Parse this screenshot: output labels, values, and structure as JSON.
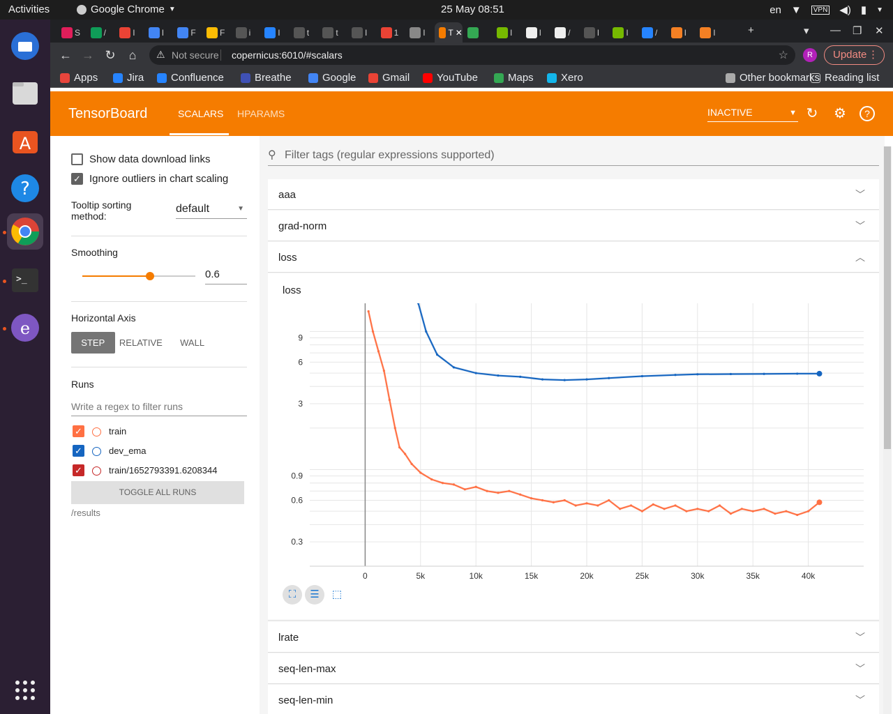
{
  "system": {
    "activities": "Activities",
    "app_name": "Google Chrome",
    "clock": "25 May  08:51",
    "lang": "en"
  },
  "browser": {
    "tabs": [
      {
        "label": "S",
        "color": "#e01e5a"
      },
      {
        "label": "/",
        "color": "#0f9d58"
      },
      {
        "label": "I",
        "color": "#ea4335"
      },
      {
        "label": "I",
        "color": "#4285f4"
      },
      {
        "label": "F",
        "color": "#4285f4"
      },
      {
        "label": "F",
        "color": "#fbbc04"
      },
      {
        "label": "i",
        "color": "#555555"
      },
      {
        "label": "I",
        "color": "#2684ff"
      },
      {
        "label": "t",
        "color": "#555555"
      },
      {
        "label": "t",
        "color": "#555555"
      },
      {
        "label": "I",
        "color": "#555555"
      },
      {
        "label": "1",
        "color": "#ea4335"
      },
      {
        "label": "I",
        "color": "#888888"
      },
      {
        "label": "T",
        "color": "#f57c00"
      },
      {
        "label": "",
        "color": "#34a853"
      },
      {
        "label": "I",
        "color": "#76b900"
      },
      {
        "label": "I",
        "color": "#eeeeee"
      },
      {
        "label": "/",
        "color": "#eeeeee"
      },
      {
        "label": "I",
        "color": "#555555"
      },
      {
        "label": "I",
        "color": "#76b900"
      },
      {
        "label": "/",
        "color": "#2684ff"
      },
      {
        "label": "I",
        "color": "#f48024"
      },
      {
        "label": "I",
        "color": "#f48024"
      }
    ],
    "omnibox": {
      "security": "Not secure",
      "url": "copernicus:6010/#scalars"
    },
    "avatar": "R",
    "update_label": "Update",
    "bookmarks": [
      {
        "label": "Apps",
        "color": "#e8453c"
      },
      {
        "label": "Jira",
        "color": "#2684ff"
      },
      {
        "label": "Confluence",
        "color": "#2684ff"
      },
      {
        "label": "Breathe",
        "color": "#3f51b5"
      },
      {
        "label": "Google",
        "color": "#4285f4"
      },
      {
        "label": "Gmail",
        "color": "#ea4335"
      },
      {
        "label": "YouTube",
        "color": "#ff0000"
      },
      {
        "label": "Maps",
        "color": "#34a853"
      },
      {
        "label": "Xero",
        "color": "#13b5ea"
      }
    ],
    "other_bookmarks": "Other bookmarks",
    "reading_list": "Reading list"
  },
  "tensorboard": {
    "logo": "TensorBoard",
    "tabs": [
      "SCALARS",
      "HPARAMS"
    ],
    "status": "INACTIVE"
  },
  "sidebar": {
    "show_download_links": "Show data download links",
    "ignore_outliers": "Ignore outliers in chart scaling",
    "tooltip_sorting_label": "Tooltip sorting method:",
    "tooltip_sorting_value": "default",
    "smoothing_label": "Smoothing",
    "smoothing_value": "0.6",
    "horizontal_axis_label": "Horizontal Axis",
    "axis_options": [
      "STEP",
      "RELATIVE",
      "WALL"
    ],
    "runs_label": "Runs",
    "runs_filter_placeholder": "Write a regex to filter runs",
    "runs": [
      {
        "name": "train",
        "color": "#ff7043"
      },
      {
        "name": "dev_ema",
        "color": "#1565c0"
      },
      {
        "name": "train/1652793391.6208344",
        "color": "#c62828"
      }
    ],
    "toggle_all": "TOGGLE ALL RUNS",
    "logdir": "/results"
  },
  "main": {
    "filter_placeholder": "Filter tags (regular expressions supported)",
    "groups_top": [
      "aaa",
      "grad-norm",
      "loss"
    ],
    "groups_bottom": [
      "lrate",
      "seq-len-max",
      "seq-len-min"
    ]
  },
  "chart_data": {
    "type": "line",
    "title": "loss",
    "xlabel": "",
    "ylabel": "",
    "log_y": true,
    "x_ticks": [
      "0",
      "5k",
      "10k",
      "15k",
      "20k",
      "25k",
      "30k",
      "35k",
      "40k"
    ],
    "y_ticks": [
      "0.3",
      "0.6",
      "0.9",
      "3",
      "6",
      "9"
    ],
    "xlim": [
      -5000,
      45000
    ],
    "ylim": [
      0.2,
      16
    ],
    "series": [
      {
        "name": "dev_ema",
        "color": "#1565c0",
        "x": [
          4800,
          5500,
          6500,
          8000,
          10000,
          12000,
          14000,
          16000,
          18000,
          20000,
          22000,
          25000,
          28000,
          30000,
          33000,
          36000,
          39000,
          41000
        ],
        "y": [
          16,
          10,
          6.8,
          5.5,
          5.0,
          4.8,
          4.7,
          4.5,
          4.45,
          4.5,
          4.6,
          4.75,
          4.85,
          4.9,
          4.92,
          4.93,
          4.95,
          4.95
        ]
      },
      {
        "name": "train",
        "color": "#ff7043",
        "x": [
          300,
          700,
          1200,
          1700,
          2200,
          2700,
          3100,
          3600,
          4200,
          5000,
          6000,
          7000,
          8000,
          9000,
          10000,
          11000,
          12000,
          13000,
          14000,
          15000,
          16000,
          17000,
          18000,
          19000,
          20000,
          21000,
          22000,
          23000,
          24000,
          25000,
          26000,
          27000,
          28000,
          29000,
          30000,
          31000,
          32000,
          33000,
          34000,
          35000,
          36000,
          37000,
          38000,
          39000,
          40000,
          41000
        ],
        "y": [
          14,
          10,
          7.2,
          5.2,
          3.2,
          2.0,
          1.45,
          1.3,
          1.1,
          0.95,
          0.85,
          0.8,
          0.78,
          0.72,
          0.75,
          0.7,
          0.68,
          0.7,
          0.66,
          0.62,
          0.6,
          0.58,
          0.6,
          0.55,
          0.57,
          0.55,
          0.6,
          0.52,
          0.55,
          0.5,
          0.56,
          0.52,
          0.55,
          0.5,
          0.52,
          0.5,
          0.55,
          0.48,
          0.52,
          0.5,
          0.52,
          0.48,
          0.5,
          0.47,
          0.5,
          0.58
        ]
      }
    ]
  }
}
